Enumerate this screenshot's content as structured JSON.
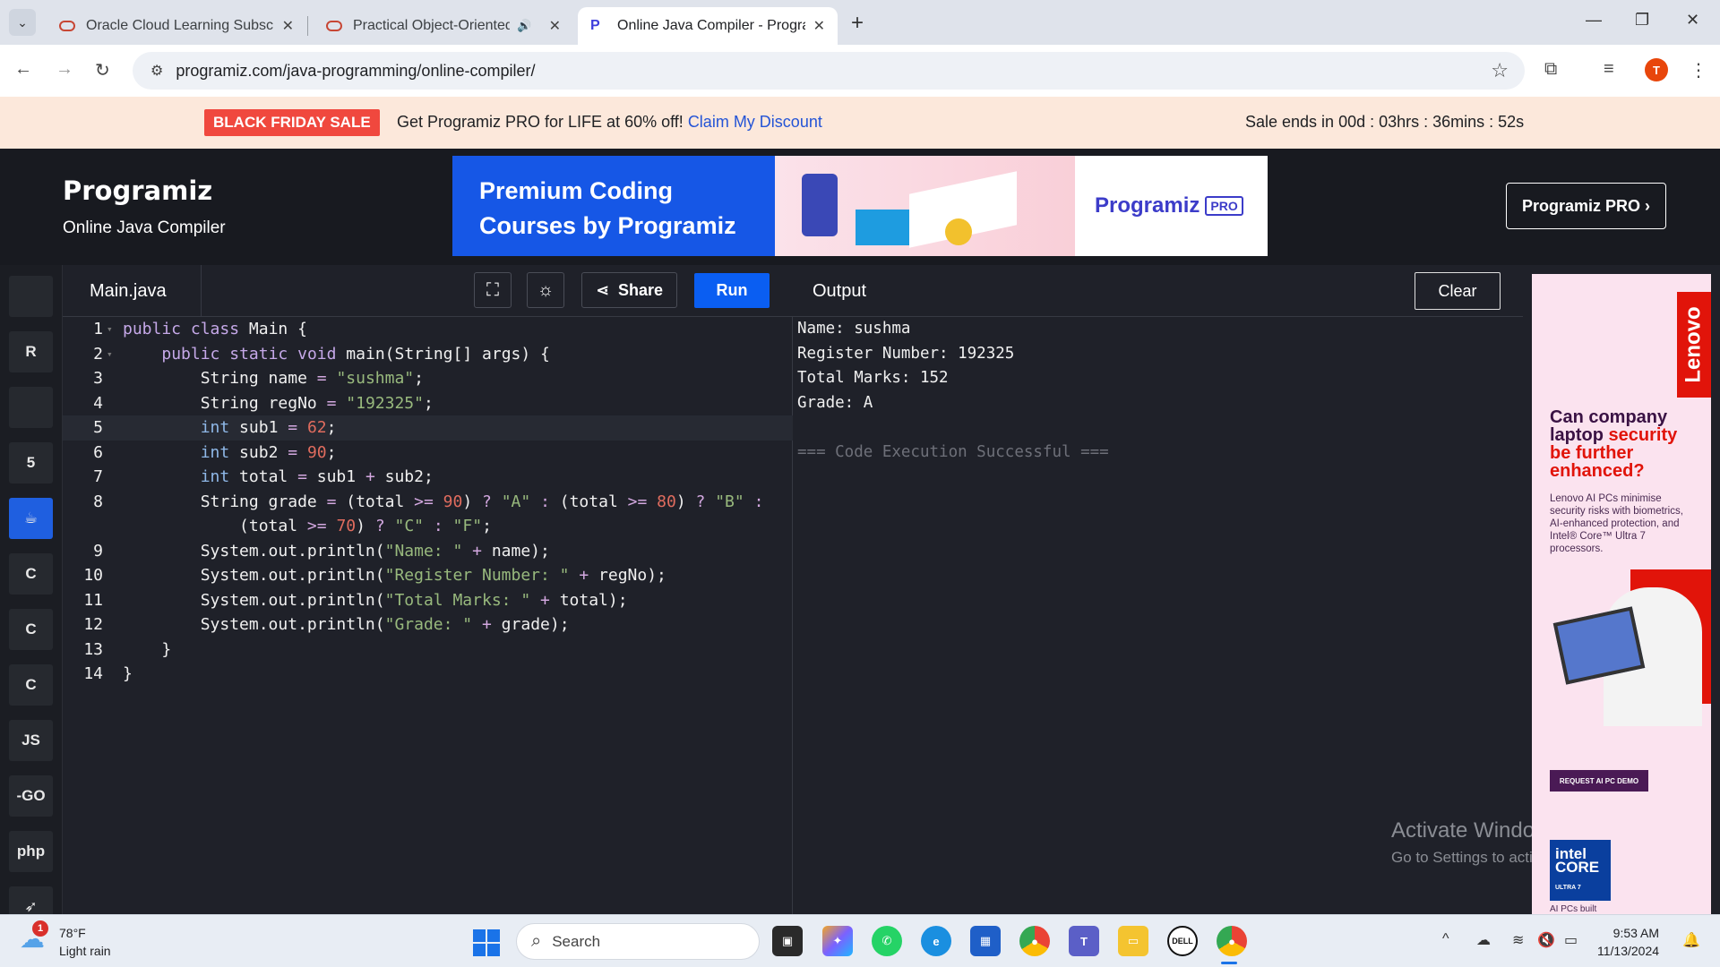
{
  "browser": {
    "tabs": [
      {
        "label": "Oracle Cloud Learning Subscrip"
      },
      {
        "label": "Practical Object-Oriented C"
      },
      {
        "label": "Online Java Compiler - Progran"
      }
    ],
    "url": "programiz.com/java-programming/online-compiler/",
    "profile_initial": "T"
  },
  "sale": {
    "badge": "BLACK FRIDAY SALE",
    "text": "Get Programiz PRO for LIFE at 60% off!",
    "link": "Claim My Discount",
    "timer": "Sale ends in 00d : 03hrs : 36mins : 52s"
  },
  "header": {
    "logo": "Programiz",
    "subtitle": "Online Java Compiler",
    "ad": {
      "line1": "Premium Coding",
      "line2": "Courses by Programiz",
      "brand": "Programiz",
      "badge": "PRO"
    },
    "pro_button": "Programiz PRO ›"
  },
  "languages": [
    {
      "name": "python-icon",
      "label": ""
    },
    {
      "name": "r-icon",
      "label": "R"
    },
    {
      "name": "sql-icon",
      "label": ""
    },
    {
      "name": "html-icon",
      "label": "5"
    },
    {
      "name": "java-icon",
      "label": "☕",
      "active": true
    },
    {
      "name": "c-icon",
      "label": "C"
    },
    {
      "name": "cpp-icon",
      "label": "C"
    },
    {
      "name": "csharp-icon",
      "label": "C"
    },
    {
      "name": "js-icon",
      "label": "JS"
    },
    {
      "name": "go-icon",
      "label": "-GO"
    },
    {
      "name": "php-icon",
      "label": "php"
    },
    {
      "name": "swift-icon",
      "label": "➶"
    }
  ],
  "editor": {
    "file_tab": "Main.java",
    "share_label": "Share",
    "run_label": "Run",
    "line_numbers": [
      "1",
      "2",
      "3",
      "4",
      "5",
      "6",
      "7",
      "8",
      "",
      "9",
      "10",
      "11",
      "12",
      "13",
      "14"
    ]
  },
  "output": {
    "title": "Output",
    "clear_label": "Clear",
    "lines": [
      "Name: sushma",
      "Register Number: 192325",
      "Total Marks: 152",
      "Grade: A"
    ],
    "success": "=== Code Execution Successful ==="
  },
  "watermark": {
    "line1": "Activate Windows",
    "line2": "Go to Settings to activate Windows."
  },
  "side_ad": {
    "brand": "Lenovo",
    "headline_a": "Can company laptop ",
    "headline_b": "security be further enhanced?",
    "copy": "Lenovo AI PCs minimise security risks with biometrics, AI-enhanced protection, and Intel® Core™ Ultra 7 processors.",
    "cta": "REQUEST AI PC DEMO",
    "intel_line1": "intel",
    "intel_line2": "CORE",
    "intel_line3": "ULTRA 7",
    "footer": "AI PCs built"
  },
  "taskbar": {
    "weather_temp": "78°F",
    "weather_desc": "Light rain",
    "weather_badge": "1",
    "search_placeholder": "Search",
    "time": "9:53 AM",
    "date": "11/13/2024"
  }
}
